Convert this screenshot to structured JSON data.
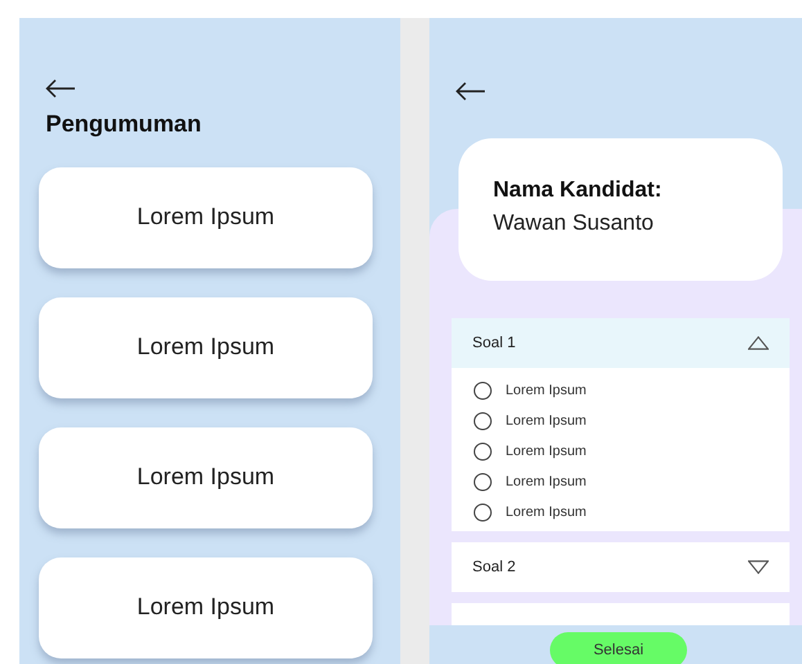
{
  "announcements": {
    "title": "Pengumuman",
    "items": [
      "Lorem Ipsum",
      "Lorem Ipsum",
      "Lorem Ipsum",
      "Lorem Ipsum"
    ]
  },
  "exam": {
    "candidate_label": "Nama Kandidat:",
    "candidate_name": "Wawan Susanto",
    "questions": [
      {
        "title": "Soal 1",
        "expanded": true,
        "options": [
          {
            "label": "Lorem Ipsum",
            "selected": false
          },
          {
            "label": "Lorem Ipsum",
            "selected": false
          },
          {
            "label": "Lorem Ipsum",
            "selected": false
          },
          {
            "label": "Lorem Ipsum",
            "selected": false
          },
          {
            "label": "Lorem Ipsum",
            "selected": false
          }
        ]
      },
      {
        "title": "Soal 2",
        "expanded": false
      },
      {
        "expanded": false
      }
    ],
    "finish_button": "Selesai"
  }
}
